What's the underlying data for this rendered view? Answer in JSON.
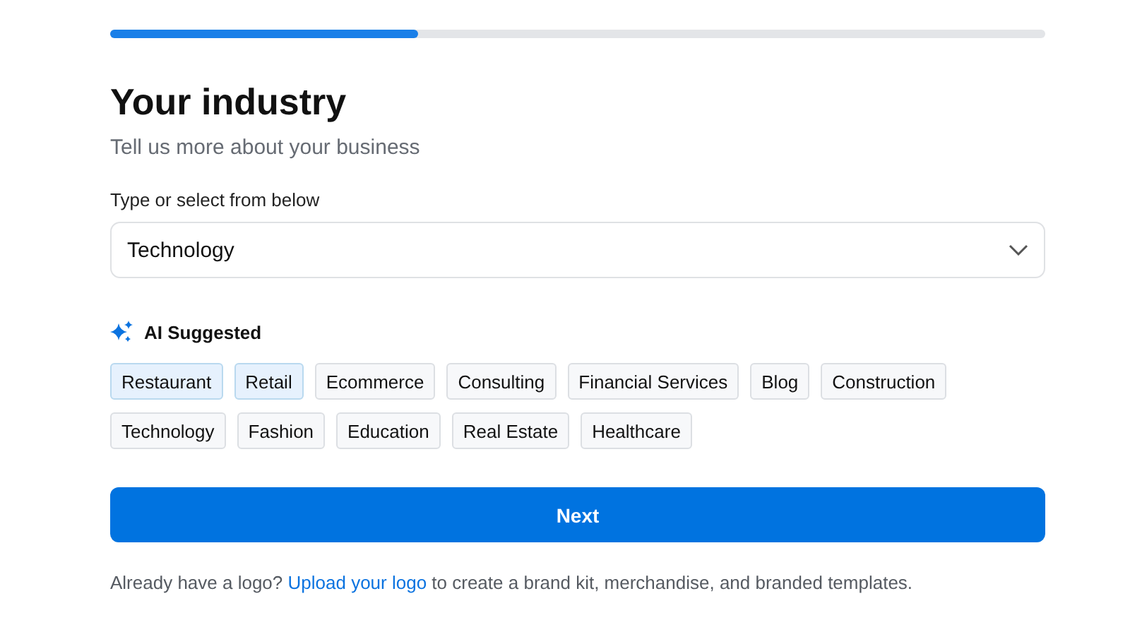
{
  "progress": {
    "level": 0.33
  },
  "title": "Your industry",
  "subtitle": "Tell us more about your business",
  "field": {
    "label": "Type or select from below",
    "value": "Technology"
  },
  "suggestions": {
    "heading": "AI Suggested",
    "chips": [
      {
        "label": "Restaurant",
        "suggested": true
      },
      {
        "label": "Retail",
        "suggested": true
      },
      {
        "label": "Ecommerce",
        "suggested": false
      },
      {
        "label": "Consulting",
        "suggested": false
      },
      {
        "label": "Financial Services",
        "suggested": false
      },
      {
        "label": "Blog",
        "suggested": false
      },
      {
        "label": "Construction",
        "suggested": false
      },
      {
        "label": "Technology",
        "suggested": false
      },
      {
        "label": "Fashion",
        "suggested": false
      },
      {
        "label": "Education",
        "suggested": false
      },
      {
        "label": "Real Estate",
        "suggested": false
      },
      {
        "label": "Healthcare",
        "suggested": false
      }
    ]
  },
  "next_button": "Next",
  "footer": {
    "before": "Already have a logo?",
    "link": "Upload your logo",
    "after": "to create a brand kit, merchandise, and branded templates."
  }
}
